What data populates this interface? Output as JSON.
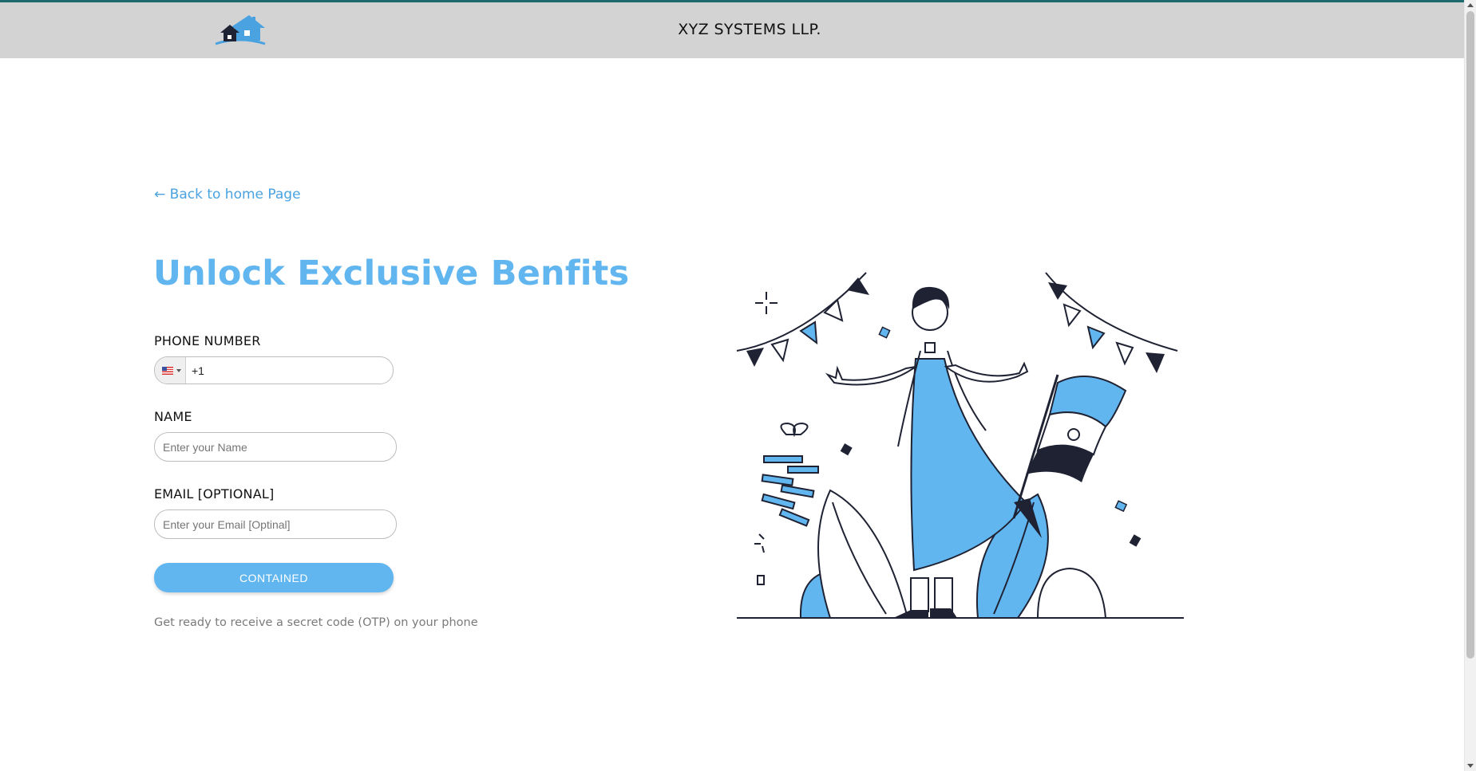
{
  "header": {
    "brand": "XYZ SYSTEMS LLP.",
    "logo_icon": "house-logo-icon"
  },
  "back_link": {
    "arrow": "←",
    "label": "Back to home Page"
  },
  "form": {
    "title": "Unlock Exclusive Benfits",
    "phone": {
      "label": "PHONE NUMBER",
      "value": "+1",
      "country_icon": "us-flag-icon"
    },
    "name": {
      "label": "NAME",
      "placeholder": "Enter your Name"
    },
    "email": {
      "label": "EMAIL [OPTIONAL]",
      "placeholder": "Enter your Email [Optinal]"
    },
    "submit_label": "CONTAINED",
    "hint": "Get ready to receive a secret code (OTP) on your phone"
  },
  "colors": {
    "accent": "#62b6f0",
    "link": "#4aa3e0",
    "header_bg": "#d3d3d3",
    "navy": "#1e2233"
  }
}
